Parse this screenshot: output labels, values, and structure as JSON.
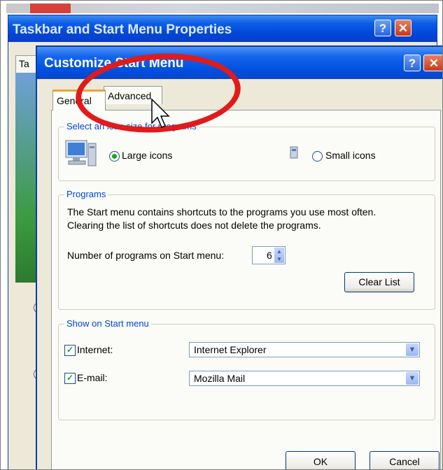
{
  "back_window": {
    "title": "Taskbar and Start Menu Properties",
    "tab_stub": "Ta",
    "help_glyph": "?",
    "close_glyph": "✕"
  },
  "dialog": {
    "title": "Customize Start Menu",
    "help_glyph": "?",
    "close_glyph": "✕",
    "tabs": [
      {
        "label": "General",
        "selected": true
      },
      {
        "label": "Advanced",
        "selected": false
      }
    ],
    "icon_size": {
      "legend": "Select an icon size for programs",
      "large_label": "Large icons",
      "small_label": "Small icons",
      "selected": "Large icons"
    },
    "programs": {
      "legend": "Programs",
      "description_line1": "The Start menu contains shortcuts to the programs you use most often.",
      "description_line2": "Clearing the list of shortcuts does not delete the programs.",
      "count_label": "Number of programs on Start menu:",
      "count_value": "6",
      "clear_button": "Clear List"
    },
    "show_on_start": {
      "legend": "Show on Start menu",
      "internet_label": "Internet:",
      "internet_checked": true,
      "internet_value": "Internet Explorer",
      "email_label": "E-mail:",
      "email_checked": true,
      "email_value": "Mozilla Mail"
    },
    "ok_button": "OK",
    "cancel_button": "Cancel"
  },
  "annotation": {
    "highlight_color": "#e11a1a"
  }
}
